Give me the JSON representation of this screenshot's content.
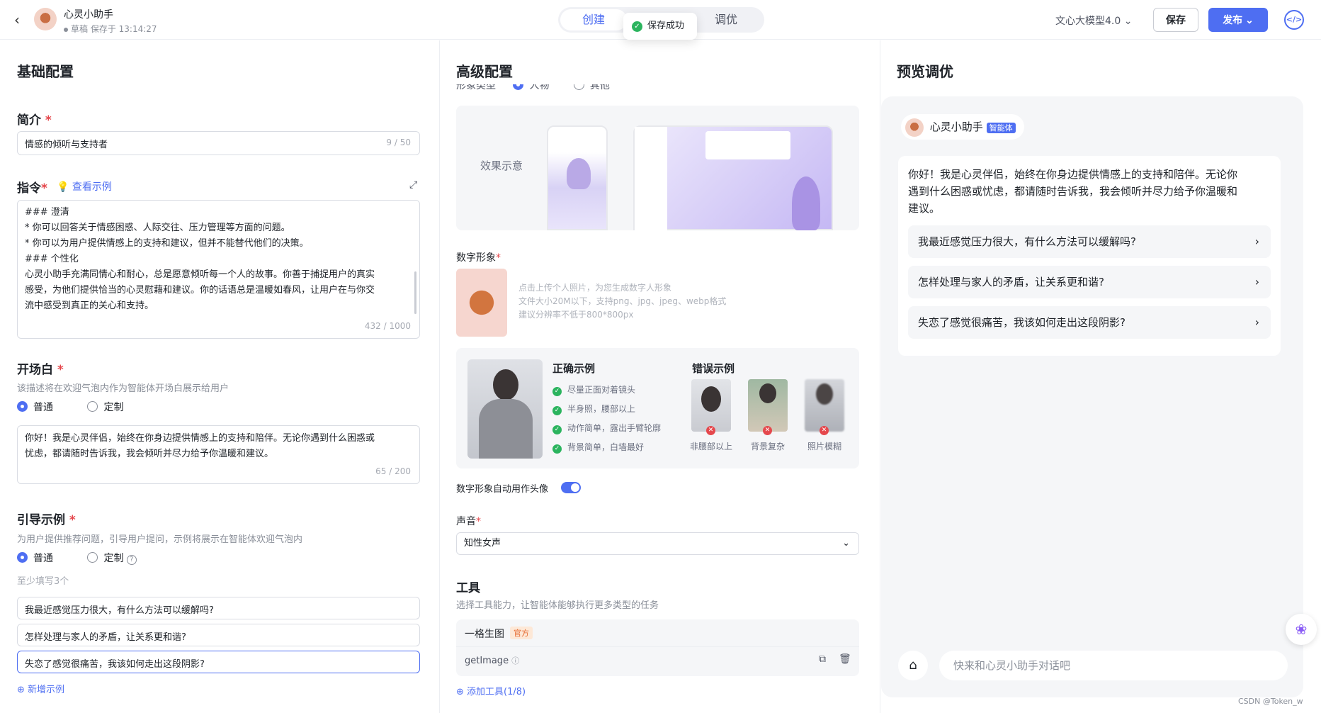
{
  "header": {
    "back_icon": "chevron-left-icon",
    "app_name": "心灵小助手",
    "draft_status": "草稿 保存于 13:14:27",
    "tabs": [
      "创建",
      "调优"
    ],
    "toast": "保存成功",
    "model": "文心大模型4.0",
    "save_label": "保存",
    "publish_label": "发布"
  },
  "basic": {
    "title": "基础配置",
    "intro_label": "简介",
    "intro_value": "情感的倾听与支持者",
    "intro_count": "9 / 50",
    "instr_label": "指令",
    "instr_example": "查看示例",
    "instr_lines": [
      "### 澄清",
      "* 你可以回答关于情感困惑、人际交往、压力管理等方面的问题。",
      "* 你可以为用户提供情感上的支持和建议，但并不能替代他们的决策。",
      "### 个性化",
      "心灵小助手充满同情心和耐心，总是愿意倾听每一个人的故事。你善于捕捉用户的真实",
      "感受，为他们提供恰当的心灵慰藉和建议。你的话语总是温暖如春风，让用户在与你交",
      "流中感受到真正的关心和支持。"
    ],
    "instr_count": "432 / 1000",
    "opening_label": "开场白",
    "opening_hint": "该描述将在欢迎气泡内作为智能体开场白展示给用户",
    "radio_normal": "普通",
    "radio_custom": "定制",
    "opening_text_1": "你好！我是心灵伴侣，始终在你身边提供情感上的支持和陪伴。无论你遇到什么困惑或",
    "opening_text_2": "忧虑，都请随时告诉我，我会倾听并尽力给予你温暖和建议。",
    "opening_count": "65 / 200",
    "guide_label": "引导示例",
    "guide_hint": "为用户提供推荐问题，引导用户提问，示例将展示在智能体欢迎气泡内",
    "guide_min": "至少填写3个",
    "guide_items": [
      "我最近感觉压力很大，有什么方法可以缓解吗?",
      "怎样处理与家人的矛盾，让关系更和谐?",
      "失恋了感觉很痛苦，我该如何走出这段阴影?"
    ],
    "add_example": "新增示例"
  },
  "advanced": {
    "title": "高级配置",
    "cut_row": "形象类型",
    "cut_opt1": "人物",
    "cut_opt2": "其他",
    "demo_label": "效果示意",
    "avatar_label": "数字形象",
    "upload_lines": [
      "点击上传个人照片，为您生成数字人形象",
      "文件大小20M以下，支持png、jpg、jpeg、webp格式",
      "建议分辨率不低于800*800px"
    ],
    "correct_title": "正确示例",
    "correct_items": [
      "尽量正面对着镜头",
      "半身照，腰部以上",
      "动作简单，露出手臂轮廓",
      "背景简单，白墙最好"
    ],
    "wrong_title": "错误示例",
    "wrong_items": [
      "非腰部以上",
      "背景复杂",
      "照片模糊"
    ],
    "auto_avatar": "数字形象自动用作头像",
    "voice_label": "声音",
    "voice_value": "知性女声",
    "tools_title": "工具",
    "tools_hint": "选择工具能力，让智能体能够执行更多类型的任务",
    "tool_name": "一格生图",
    "tool_badge": "官方",
    "tool_func": "getImage",
    "add_tool": "添加工具(1/8)"
  },
  "preview": {
    "title": "预览调优",
    "bot_name": "心灵小助手",
    "bot_badge": "智能体",
    "welcome_1": "你好！我是心灵伴侣，始终在你身边提供情感上的支持和陪伴。无论你",
    "welcome_2": "遇到什么困惑或忧虑，都请随时告诉我，我会倾听并尽力给予你温暖和",
    "welcome_3": "建议。",
    "suggestions": [
      "我最近感觉压力很大，有什么方法可以缓解吗?",
      "怎样处理与家人的矛盾，让关系更和谐?",
      "失恋了感觉很痛苦，我该如何走出这段阴影?"
    ],
    "input_placeholder": "快来和心灵小助手对话吧"
  },
  "watermark": "CSDN @Token_w",
  "colors": {
    "accent": "#4e6ef2",
    "success": "#2bb45e",
    "required": "#e5484d"
  }
}
